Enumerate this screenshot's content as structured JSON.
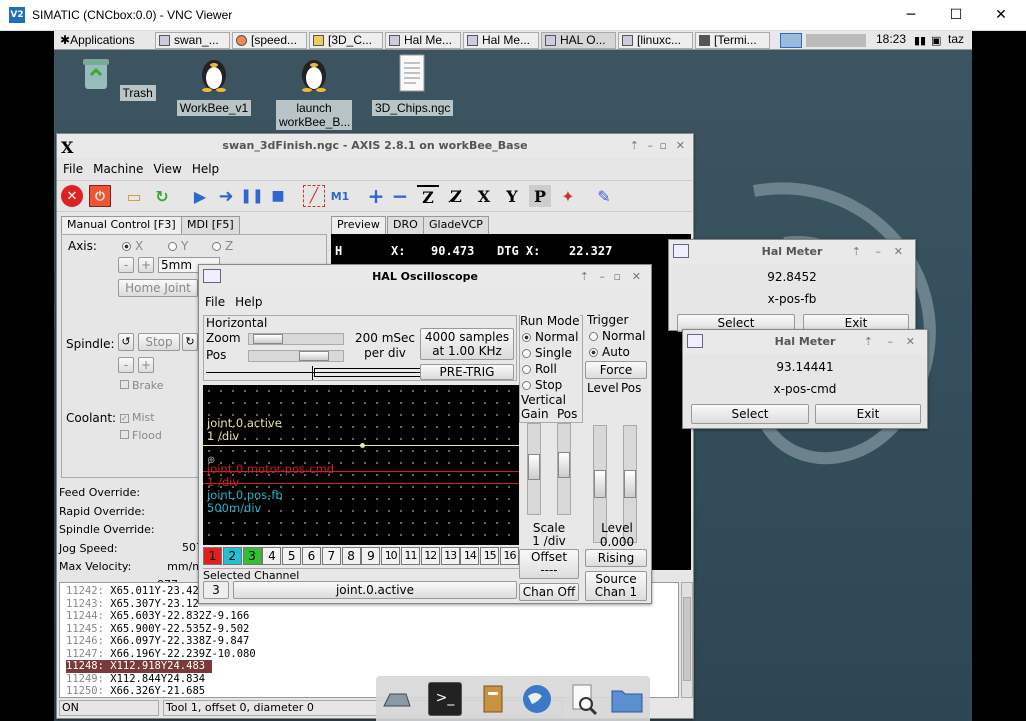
{
  "window": {
    "title": "SIMATIC (CNCbox:0.0) - VNC Viewer",
    "logo": "V2",
    "controls": [
      "─",
      "☐",
      "✕"
    ]
  },
  "panel": {
    "applications": "Applications",
    "tasks": [
      {
        "label": "swan_..."
      },
      {
        "label": "[speed..."
      },
      {
        "label": "[3D_C..."
      },
      {
        "label": "Hal Me..."
      },
      {
        "label": "Hal Me..."
      },
      {
        "label": "HAL O..."
      },
      {
        "label": "[linuxc..."
      },
      {
        "label": "[Termi..."
      }
    ],
    "clock": "18:23",
    "user": "taz"
  },
  "desktop_icons": [
    {
      "label": "Trash"
    },
    {
      "label": "WorkBee_v1"
    },
    {
      "label": "launch workBee_B..."
    },
    {
      "label": "3D_Chips.ngc"
    }
  ],
  "axis": {
    "title": "swan_3dFinish.ngc - AXIS 2.8.1 on workBee_Base",
    "menu": [
      "File",
      "Machine",
      "View",
      "Help"
    ],
    "tabs_left": [
      "Manual Control [F3]",
      "MDI [F5]"
    ],
    "tabs_right": [
      "Preview",
      "DRO",
      "GladeVCP"
    ],
    "axis_label": "Axis:",
    "axis_opts": [
      "X",
      "Y",
      "Z"
    ],
    "step": "5mm",
    "home_joint": "Home Joint",
    "spindle_label": "Spindle:",
    "stop": "Stop",
    "brake": "Brake",
    "coolant_label": "Coolant:",
    "mist": "Mist",
    "flood": "Flood",
    "overrides": [
      {
        "label": "Feed Override:",
        "value": ""
      },
      {
        "label": "Rapid Override:",
        "value": ""
      },
      {
        "label": "Spindle Override:",
        "value": ""
      },
      {
        "label": "Jog Speed:",
        "value": "507 mm/m"
      },
      {
        "label": "Max Velocity:",
        "value": "977 mm"
      }
    ],
    "preview": {
      "h": "H",
      "axis": "X:",
      "pos": "90.473",
      "dtg_label": "DTG X:",
      "dtg": "22.327"
    },
    "code_lines": [
      {
        "n": "11242:",
        "t": "X65.011Y-23.42"
      },
      {
        "n": "11243:",
        "t": "X65.307Y-23.12"
      },
      {
        "n": "11244:",
        "t": "X65.603Y-22.832Z-9.166"
      },
      {
        "n": "11245:",
        "t": "X65.900Y-22.535Z-9.502"
      },
      {
        "n": "11246:",
        "t": "X66.097Y-22.338Z-9.847"
      },
      {
        "n": "11247:",
        "t": "X66.196Y-22.239Z-10.080"
      },
      {
        "n": "11248:",
        "t": "X112.918Y24.483"
      },
      {
        "n": "11249:",
        "t": "X112.844Y24.834"
      },
      {
        "n": "11250:",
        "t": "X66.326Y-21.685"
      }
    ],
    "status": {
      "state": "ON",
      "tool": "Tool 1, offset 0, diameter 0"
    }
  },
  "scope": {
    "title": "HAL Oscilloscope",
    "menu": [
      "File",
      "Help"
    ],
    "horizontal": "Horizontal",
    "zoom": "Zoom",
    "pos": "Pos",
    "rate": "200 mSec",
    "per_div": "per div",
    "samples": "4000 samples",
    "khz": "at 1.00 KHz",
    "pretrig": "PRE-TRIG",
    "run_mode": "Run Mode",
    "run_opts": [
      {
        "label": "Normal",
        "on": true
      },
      {
        "label": "Single",
        "on": false
      },
      {
        "label": "Roll",
        "on": false
      },
      {
        "label": "Stop",
        "on": false
      }
    ],
    "vertical": "Vertical",
    "gain": "Gain",
    "vpos": "Pos",
    "scale_label": "Scale",
    "scale_val": "1 /div",
    "offset_btn": "Offset",
    "offset_val": "----",
    "chan_off": "Chan Off",
    "trigger": "Trigger",
    "trig_opts": [
      {
        "label": "Normal",
        "on": false
      },
      {
        "label": "Auto",
        "on": true
      }
    ],
    "force": "Force",
    "level": "Level",
    "tpos": "Pos",
    "level_label": "Level",
    "level_val": "0.000",
    "rising": "Rising",
    "source": "Source",
    "source_chan": "Chan  1",
    "traces": [
      {
        "name": "joint.0.active",
        "scale": "1 /div",
        "color": "#e6e6a0"
      },
      {
        "name": "joint.0.motor-pos-cmd",
        "scale": "1 /div",
        "color": "#cc2222"
      },
      {
        "name": "joint.0.pos-fb",
        "scale": "500m/div",
        "color": "#22b5c8"
      }
    ],
    "channels": [
      "1",
      "2",
      "3",
      "4",
      "5",
      "6",
      "7",
      "8",
      "9",
      "10",
      "11",
      "12",
      "13",
      "14",
      "15",
      "16"
    ],
    "channel_colors": [
      "#e02020",
      "#20c0d0",
      "#30c030"
    ],
    "selected_channel": "Selected Channel",
    "sel_num": "3",
    "sel_name": "joint.0.active"
  },
  "halmeter1": {
    "title": "Hal Meter",
    "value": "92.8452",
    "pin": "x-pos-fb",
    "select": "Select",
    "exit": "Exit"
  },
  "halmeter2": {
    "title": "Hal Meter",
    "value": "93.14441",
    "pin": "x-pos-cmd",
    "select": "Select",
    "exit": "Exit"
  }
}
